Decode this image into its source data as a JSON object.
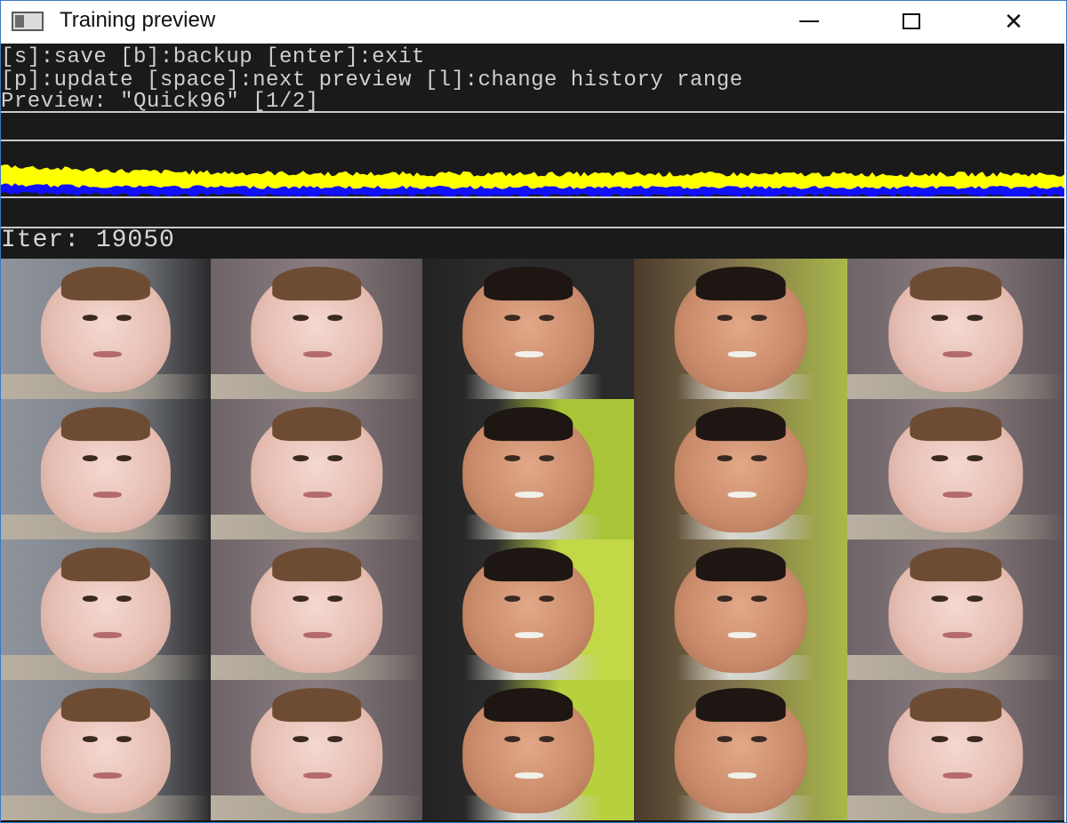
{
  "window": {
    "title": "Training preview",
    "controls": [
      "minimize",
      "maximize",
      "close"
    ],
    "close_glyph": "✕"
  },
  "console": {
    "line1": "[s]:save [b]:backup [enter]:exit",
    "line2": "[p]:update [space]:next preview [l]:change history range",
    "line3": "Preview: \"Quick96\" [1/2]",
    "iter_text": "Iter: 19050"
  },
  "loss_history": {
    "series": [
      {
        "color": "#ffff00"
      },
      {
        "color": "#1010ff"
      }
    ]
  },
  "preview": {
    "rows": 4,
    "columns": 5
  },
  "colors": {
    "background": "#141414",
    "console_text": "#cfcfcf",
    "separator": "#c9c9c9",
    "loss_a": "#ffff00",
    "loss_b": "#1010ff",
    "window_border": "#3b78c4"
  }
}
